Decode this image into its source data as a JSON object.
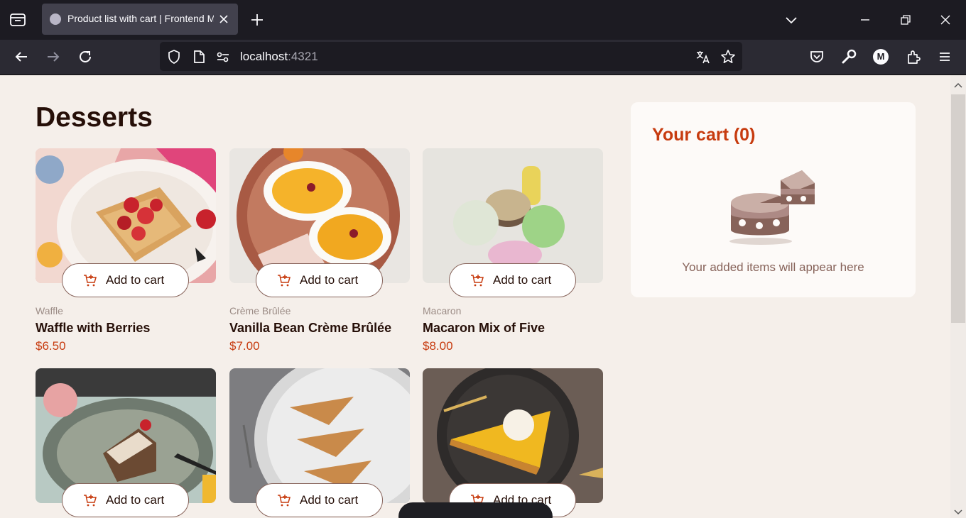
{
  "browser": {
    "tab_title": "Product list with cart | Frontend Mentor",
    "url_host": "localhost",
    "url_port": ":4321",
    "account_initial": "M"
  },
  "page": {
    "heading": "Desserts"
  },
  "add_to_cart_label": "Add to cart",
  "products": [
    {
      "category": "Waffle",
      "name": "Waffle with Berries",
      "price": "$6.50"
    },
    {
      "category": "Crème Brûlée",
      "name": "Vanilla Bean Crème Brûlée",
      "price": "$7.00"
    },
    {
      "category": "Macaron",
      "name": "Macaron Mix of Five",
      "price": "$8.00"
    },
    {
      "category": "",
      "name": "",
      "price": ""
    },
    {
      "category": "",
      "name": "",
      "price": ""
    },
    {
      "category": "",
      "name": "",
      "price": ""
    }
  ],
  "cart": {
    "title": "Your cart (0)",
    "empty_message": "Your added items will appear here"
  },
  "colors": {
    "accent": "#c73b0f",
    "heading": "#260f08",
    "background": "#f5efea"
  }
}
